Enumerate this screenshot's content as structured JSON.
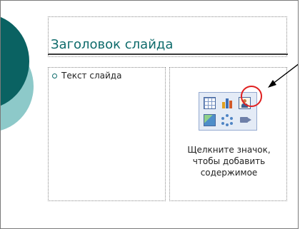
{
  "slide": {
    "title_placeholder": "Заголовок слайда",
    "text_placeholder": "Текст слайда",
    "content_hint_line1": "Щелкните значок,",
    "content_hint_line2": "чтобы добавить",
    "content_hint_line3": "содержимое"
  },
  "content_icons": [
    {
      "name": "table-icon"
    },
    {
      "name": "chart-icon"
    },
    {
      "name": "clip-art-icon",
      "highlighted": true
    },
    {
      "name": "picture-icon"
    },
    {
      "name": "diagram-icon"
    },
    {
      "name": "media-clip-icon"
    }
  ],
  "colors": {
    "accent_teal_dark": "#0a6262",
    "accent_teal_light": "#8dc9c9",
    "title_text": "#0e6b6b",
    "highlight_red": "#e02020",
    "icon_panel": "#e4ebf6"
  }
}
